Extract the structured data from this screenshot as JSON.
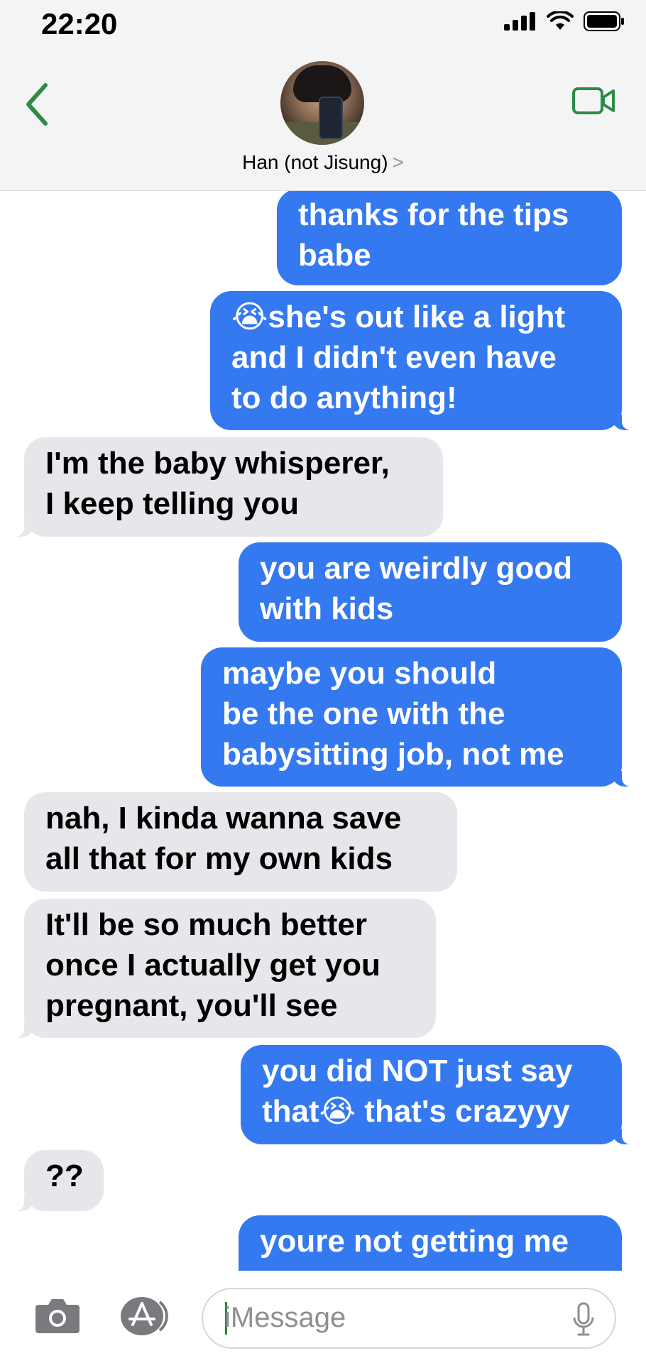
{
  "status_bar": {
    "time": "22:20"
  },
  "header": {
    "contact_name": "Han (not Jisung)",
    "chevron": ">"
  },
  "messages": [
    {
      "from": "me",
      "text": "thanks for the tips\nbabe"
    },
    {
      "from": "me",
      "text": "😭she's out like a light\nand I didn't even have\nto do anything!"
    },
    {
      "from": "them",
      "text": "I'm the baby whisperer,\nI keep telling you"
    },
    {
      "from": "me",
      "text": "you are weirdly good\nwith kids"
    },
    {
      "from": "me",
      "text": "maybe you should\nbe the one with the\nbabysitting job, not me"
    },
    {
      "from": "them",
      "text": "nah, I kinda wanna save\nall that for my own kids"
    },
    {
      "from": "them",
      "text": "It'll be so much better\nonce I actually get you\npregnant, you'll see"
    },
    {
      "from": "me",
      "text": "you did NOT just say\nthat😭 that's crazyyy"
    },
    {
      "from": "them",
      "text": "??"
    },
    {
      "from": "me",
      "text": "youre not getting me"
    }
  ],
  "composer": {
    "placeholder": "iMessage"
  },
  "icons": {
    "back": "chevron-left-icon",
    "video": "video-camera-icon",
    "camera": "camera-icon",
    "apps": "app-store-icon",
    "mic": "microphone-icon"
  },
  "colors": {
    "outgoing": "#3579f0",
    "incoming": "#e6e6eb",
    "accent": "#2e8b47"
  }
}
